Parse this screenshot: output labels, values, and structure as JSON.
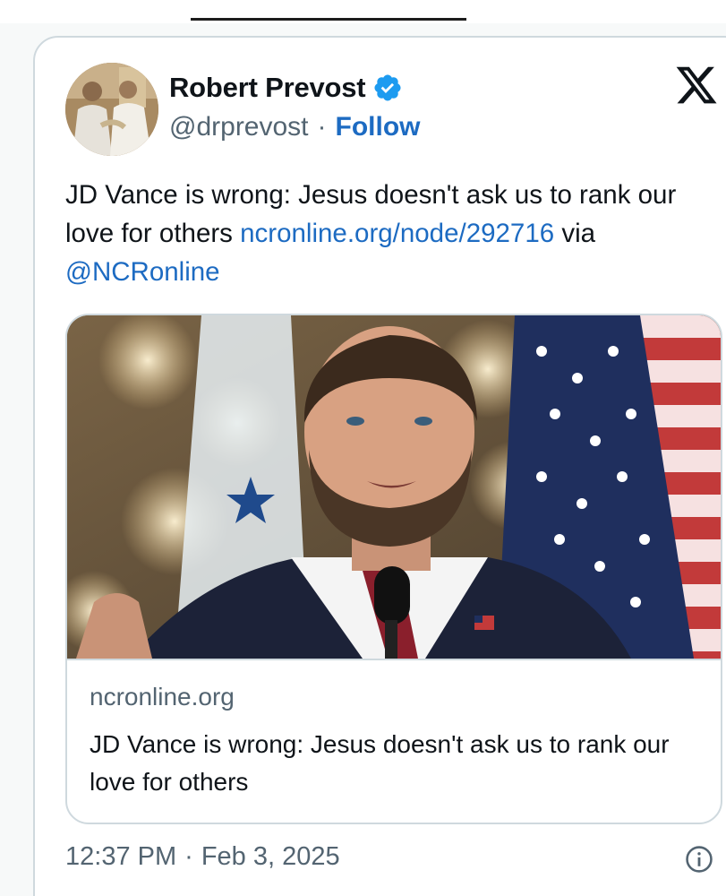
{
  "tweet": {
    "author": {
      "display_name": "Robert Prevost",
      "verified": true,
      "handle": "@drprevost",
      "separator": "·",
      "follow_label": "Follow",
      "avatar_icon": "profile-photo"
    },
    "platform_icon": "x-logo-icon",
    "text": {
      "body": "JD Vance is wrong: Jesus doesn't ask us to rank our love for others ",
      "link": "ncronline.org/node/292716",
      "via": " via ",
      "mention": "@NCRonline"
    },
    "link_card": {
      "image_subject": "JD Vance speaking at a microphone in front of flags",
      "domain": "ncronline.org",
      "title": "JD Vance is wrong: Jesus doesn't ask us to rank our love for others"
    },
    "timestamp": {
      "time": "12:37 PM",
      "separator": "·",
      "date": "Feb 3, 2025"
    },
    "info_icon": "info-icon"
  },
  "colors": {
    "link_blue": "#1d6bc2",
    "verified_blue": "#1d9bf0",
    "secondary_text": "#536471",
    "border": "#cfd9de"
  }
}
